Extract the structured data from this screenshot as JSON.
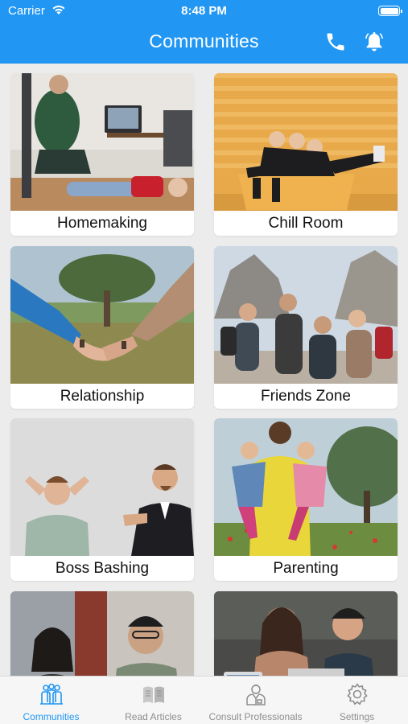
{
  "status": {
    "carrier": "Carrier",
    "time": "8:48 PM"
  },
  "header": {
    "title": "Communities",
    "accent": "#2196f3"
  },
  "communities": [
    {
      "label": "Homemaking"
    },
    {
      "label": "Chill Room"
    },
    {
      "label": "Relationship"
    },
    {
      "label": "Friends Zone"
    },
    {
      "label": "Boss Bashing"
    },
    {
      "label": "Parenting"
    },
    {
      "label": ""
    },
    {
      "label": ""
    }
  ],
  "tabs": [
    {
      "label": "Communities",
      "icon": "people-icon",
      "active": true
    },
    {
      "label": "Read Articles",
      "icon": "book-icon",
      "active": false
    },
    {
      "label": "Consult Professionals",
      "icon": "professional-icon",
      "active": false
    },
    {
      "label": "Settings",
      "icon": "gear-icon",
      "active": false
    }
  ]
}
